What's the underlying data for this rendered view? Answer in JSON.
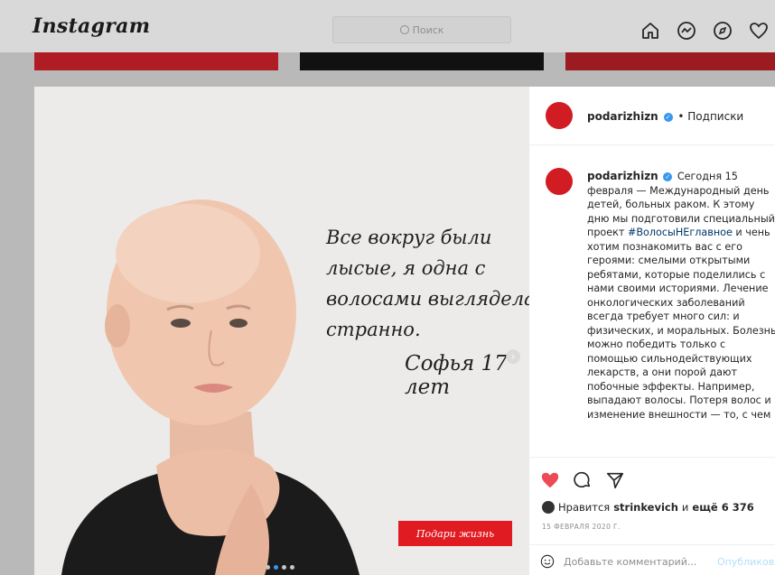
{
  "nav": {
    "logo": "Instagram",
    "search_placeholder": "Поиск",
    "icons": [
      "home-icon",
      "messenger-icon",
      "explore-icon",
      "heart-icon"
    ]
  },
  "post_image": {
    "quote_lines": [
      "Все вокруг были",
      "лысые, я одна с",
      "волосами выглядела",
      "странно."
    ],
    "signature": "Софья 17 лет",
    "brand_badge": "Подари жизнь",
    "carousel_dots": 4,
    "active_dot": 1
  },
  "header": {
    "username": "podarizhizn",
    "follow_label": "• Подписки"
  },
  "caption": {
    "username": "podarizhizn",
    "text_before_hashtag": "Сегодня 15 февраля — Международный день детей, больных раком. К этому дню мы подготовили специальный проект",
    "hashtag": "#ВолосыНЕглавное",
    "text_after_hashtag": "и чень хотим познакомить вас с его героями: смелыми открытыми ребятами, которые поделились с нами своими историями. Лечение онкологических заболеваний всегда требует много сил: и физических, и моральных. Болезнь можно победить только с помощью сильнодействующих лекарств, а они порой дают побочные эффекты. Например, выпадают волосы. Потеря волос и изменение внешности — то, с чем"
  },
  "actions": {
    "likes_prefix": "Нравится",
    "likes_user": "strinkevich",
    "likes_suffix_word": "и",
    "likes_more": "ещё 6 376",
    "date": "15 ФЕВРАЛЯ 2020 Г.",
    "comment_placeholder": "Добавьте комментарий...",
    "publish_label": "Опубликов"
  },
  "colors": {
    "like_red": "#ed4956",
    "brand_red": "#d11c23",
    "link_blue": "#3897f0",
    "hashtag_blue": "#003569"
  }
}
